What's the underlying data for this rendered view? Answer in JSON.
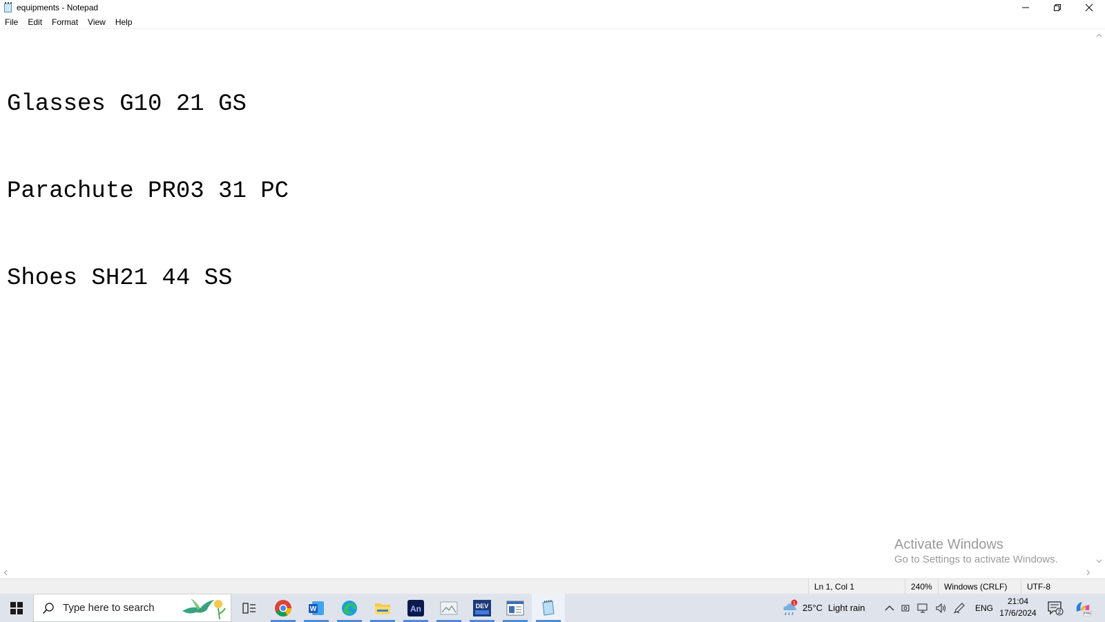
{
  "window": {
    "title": "equipments - Notepad"
  },
  "menu": {
    "file": "File",
    "edit": "Edit",
    "format": "Format",
    "view": "View",
    "help": "Help"
  },
  "editor": {
    "lines": [
      "Glasses G10 21 GS",
      "Parachute PR03 31 PC",
      "Shoes SH21 44 SS"
    ]
  },
  "watermark": {
    "line1": "Activate Windows",
    "line2": "Go to Settings to activate Windows."
  },
  "status": {
    "position": "Ln 1, Col 1",
    "zoom": "240%",
    "line_ending": "Windows (CRLF)",
    "encoding": "UTF-8"
  },
  "taskbar": {
    "search_placeholder": "Type here to search",
    "apps": [
      "chrome-icon",
      "word-icon",
      "edge-icon",
      "file-explorer-icon",
      "animate-icon",
      "image-viewer-icon",
      "dev-tool-icon",
      "app-window-icon",
      "notepad-icon"
    ],
    "weather_badge": "1",
    "weather_temp": "25°C",
    "weather_desc": "Light rain",
    "language": "ENG",
    "time": "21:04",
    "date": "17/6/2024",
    "notification_count": "2"
  },
  "colors": {
    "taskbar_bg": "#dfe4ec",
    "accent": "#4e8ad6",
    "watermark": "#9a9a9a"
  }
}
